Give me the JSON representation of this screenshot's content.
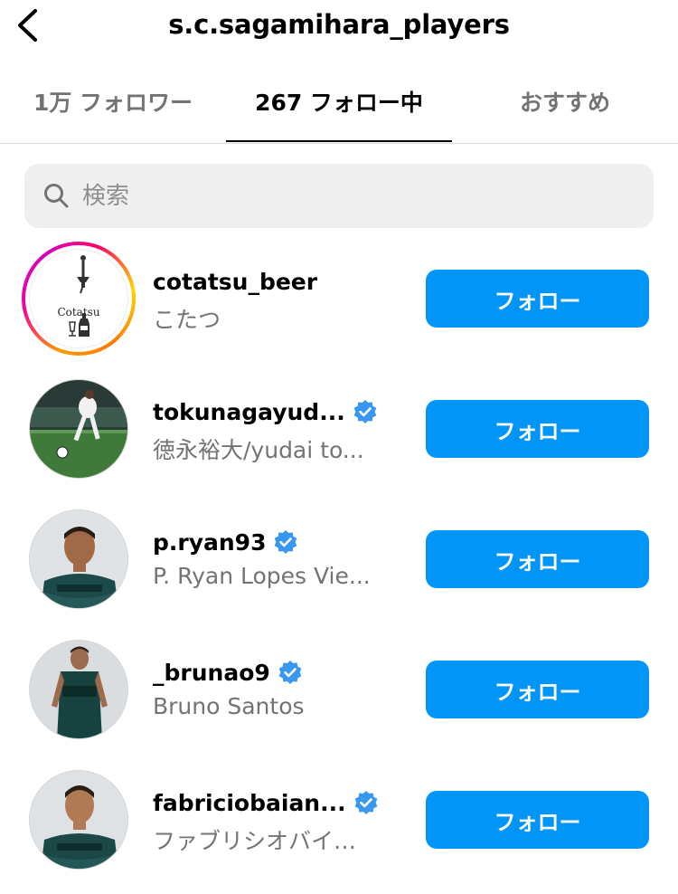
{
  "header": {
    "back_icon": "chevron-left-icon",
    "title": "s.c.sagamihara_players"
  },
  "tabs": [
    {
      "label": "1万 フォロワー",
      "active": false
    },
    {
      "label": "267 フォロー中",
      "active": true
    },
    {
      "label": "おすすめ",
      "active": false
    }
  ],
  "search": {
    "icon": "search-icon",
    "placeholder": "検索",
    "value": ""
  },
  "accent_color": "#0095f6",
  "verified_color": "#3897f0",
  "avatar_logo_text": "Cotatsu",
  "users": [
    {
      "username": "cotatsu_beer",
      "full_name": "こたつ",
      "verified": false,
      "story_ring": true,
      "button": "フォロー"
    },
    {
      "username": "tokunagayud...",
      "full_name": "徳永裕大/yudai to...",
      "verified": true,
      "story_ring": false,
      "button": "フォロー"
    },
    {
      "username": "p.ryan93",
      "full_name": "P. Ryan Lopes Vie...",
      "verified": true,
      "story_ring": false,
      "button": "フォロー"
    },
    {
      "username": "_brunao9",
      "full_name": "Bruno Santos",
      "verified": true,
      "story_ring": false,
      "button": "フォロー"
    },
    {
      "username": "fabriciobaian...",
      "full_name": "ファブリシオバイ…",
      "verified": true,
      "story_ring": false,
      "button": "フォロー"
    }
  ]
}
